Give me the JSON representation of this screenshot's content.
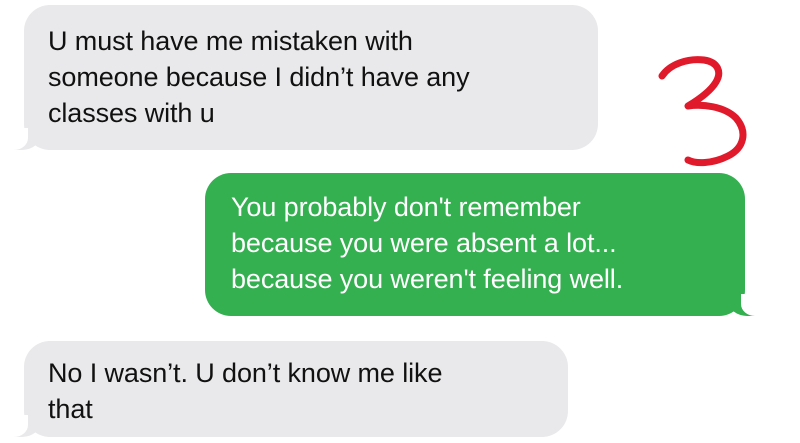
{
  "conversation": {
    "messages": [
      {
        "direction": "incoming",
        "lines": [
          "U must have me mistaken with",
          "someone because I didn’t have any",
          "classes with u"
        ]
      },
      {
        "direction": "outgoing",
        "lines": [
          "You probably don't remember",
          "because you were absent a lot...",
          "because you weren't feeling well."
        ]
      },
      {
        "direction": "incoming",
        "lines": [
          "No I wasn’t. U don’t know me like",
          "that"
        ]
      }
    ]
  },
  "annotation": {
    "label": "3",
    "color": "#e0192b"
  },
  "colors": {
    "incoming_bubble": "#e9e9eb",
    "outgoing_bubble": "#34b050",
    "incoming_text": "#111111",
    "outgoing_text": "#ffffff",
    "background": "#ffffff"
  }
}
